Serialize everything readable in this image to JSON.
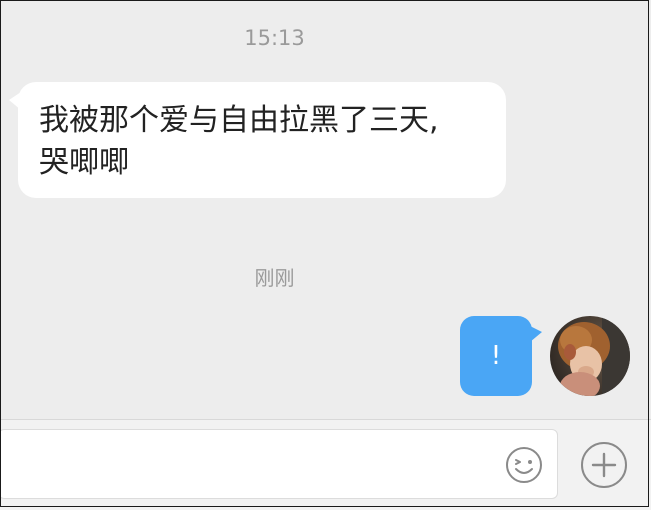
{
  "chat": {
    "timestamp": "15:13",
    "incoming_message": {
      "line1": "我被那个爱与自由拉黑了三天,",
      "line2": "哭唧唧"
    },
    "just_now_label": "刚刚",
    "outgoing_message": "!"
  },
  "input_bar": {
    "text_value": "",
    "emoji_icon": "emoji-icon",
    "plus_icon": "plus-icon"
  },
  "colors": {
    "background": "#ededed",
    "incoming_bubble": "#ffffff",
    "outgoing_bubble": "#4aa6f5",
    "meta_text": "#9a9a9a"
  }
}
